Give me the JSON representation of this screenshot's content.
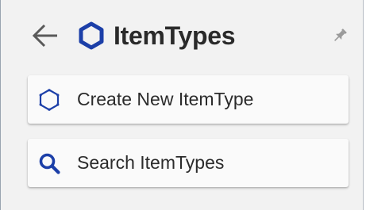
{
  "header": {
    "title": "ItemTypes",
    "back_icon": "arrow-left-icon",
    "logo_icon": "hexagon-icon",
    "pin_icon": "pin-icon"
  },
  "actions": [
    {
      "label": "Create New ItemType",
      "icon": "hexagon-outline-icon"
    },
    {
      "label": "Search ItemTypes",
      "icon": "search-icon"
    }
  ],
  "colors": {
    "accent": "#1c3fa8",
    "panel_background": "#f2f2f2",
    "button_background": "#fafafa",
    "text": "#2b2b2b",
    "icon_gray": "#555555"
  }
}
